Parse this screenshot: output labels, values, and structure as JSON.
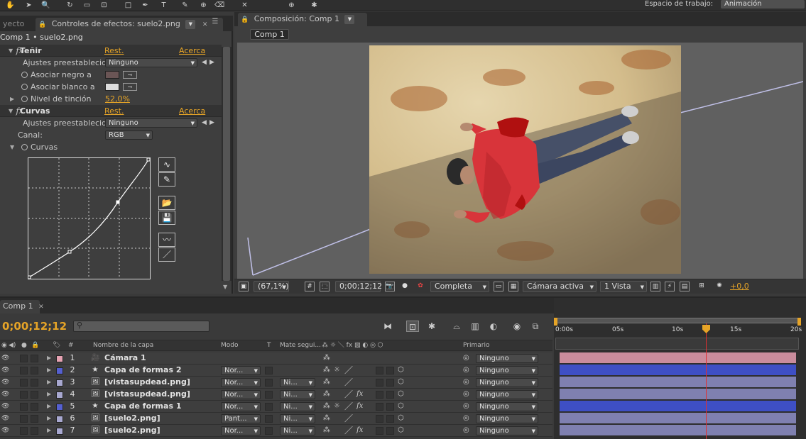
{
  "toolbar": {
    "workspace_label": "Espacio de trabajo:",
    "workspace_value": "Animación"
  },
  "effects_panel": {
    "prev_tab": "yecto",
    "tab_title": "Controles de efectos: suelo2.png",
    "subtitle": "Comp 1 • suelo2.png",
    "effects": [
      {
        "name": "Teñir",
        "reset": "Rest.",
        "about": "Acerca de...",
        "preset_label": "Ajustes preestablecid",
        "preset_value": "Ninguno",
        "map_black_label": "Asociar negro a",
        "map_white_label": "Asociar blanco a",
        "amount_label": "Nivel de tinción",
        "amount_value": "52,0%",
        "black_color": "#6a5555",
        "white_color": "#dcdcdc"
      },
      {
        "name": "Curvas",
        "reset": "Rest.",
        "about": "Acerca de...",
        "preset_label": "Ajustes preestablecid",
        "preset_value": "Ninguno",
        "channel_label": "Canal:",
        "channel_value": "RGB",
        "curves_label": "Curvas"
      }
    ]
  },
  "comp_panel": {
    "tab_title": "Composición: Comp 1",
    "breadcrumb": "Comp 1",
    "zoom": "(67,1%)",
    "timecode": "0;00;12;12",
    "resolution": "Completa",
    "camera": "Cámara activa",
    "views": "1 Vista",
    "exposure": "+0,0"
  },
  "timeline": {
    "tab_title": "Comp 1",
    "timecode": "0;00;12;12",
    "columns": {
      "source_name": "Nombre de la capa",
      "mode": "Modo",
      "t": "T",
      "track_matte": "Mate segui...",
      "parent": "Primario"
    },
    "ruler_ticks": [
      "0:00s",
      "05s",
      "10s",
      "15s",
      "20s"
    ],
    "playhead_fraction": 0.62,
    "layers": [
      {
        "num": "1",
        "name": "Cámara 1",
        "type_icon": "camera-icon",
        "label_color": "#e6a3b3",
        "mode": "",
        "matte": "",
        "parent": "Ninguno",
        "bar_color": "#c98c9c"
      },
      {
        "num": "2",
        "name": "Capa de formas 2",
        "type_icon": "star-icon",
        "label_color": "#5560d0",
        "mode": "Nor...",
        "matte": "",
        "parent": "Ninguno",
        "bar_color": "#3e4fc4"
      },
      {
        "num": "3",
        "name": "[vistasupdead.png]",
        "type_icon": "image-icon",
        "label_color": "#a8a8d0",
        "mode": "Nor...",
        "matte": "Ni...",
        "parent": "Ninguno",
        "bar_color": "#7f80b0"
      },
      {
        "num": "4",
        "name": "[vistasupdead.png]",
        "type_icon": "image-icon",
        "label_color": "#a8a8d0",
        "mode": "Nor...",
        "matte": "Ni...",
        "parent": "Ninguno",
        "bar_color": "#7f80b0"
      },
      {
        "num": "5",
        "name": "Capa de formas 1",
        "type_icon": "star-icon",
        "label_color": "#5560d0",
        "mode": "Nor...",
        "matte": "Ni...",
        "parent": "Ninguno",
        "bar_color": "#3e4fc4"
      },
      {
        "num": "6",
        "name": "[suelo2.png]",
        "type_icon": "image-icon",
        "label_color": "#a8a8d0",
        "mode": "Pant...",
        "matte": "Ni...",
        "parent": "Ninguno",
        "bar_color": "#7f80b0"
      },
      {
        "num": "7",
        "name": "[suelo2.png]",
        "type_icon": "image-icon",
        "label_color": "#a8a8d0",
        "mode": "Nor...",
        "matte": "Ni...",
        "parent": "Ninguno",
        "bar_color": "#7f80b0"
      }
    ]
  }
}
